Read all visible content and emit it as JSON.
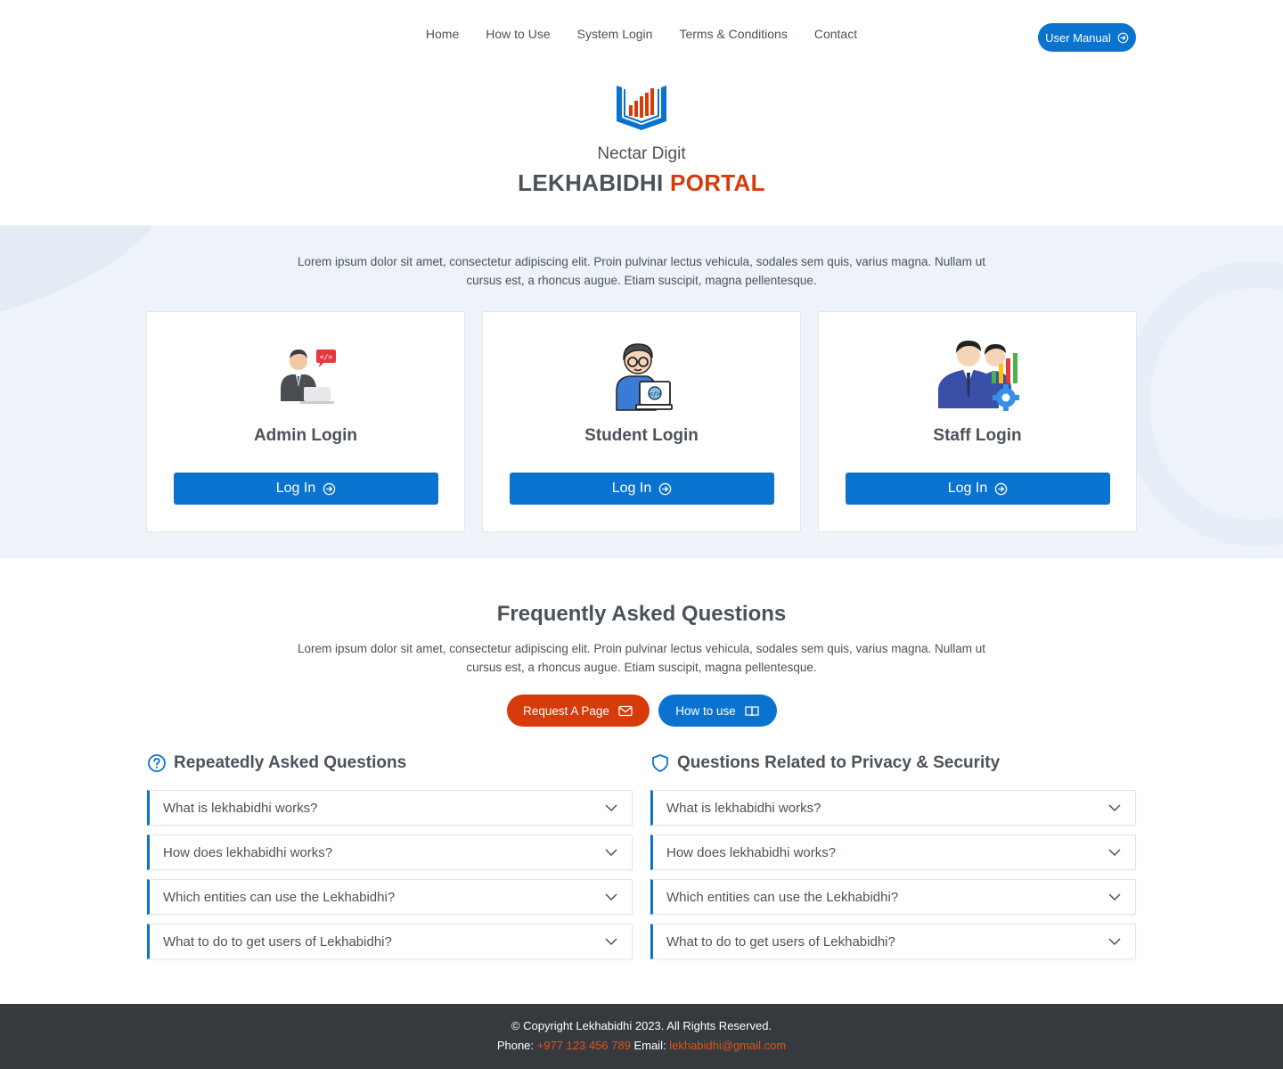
{
  "nav": {
    "links": [
      "Home",
      "How to Use",
      "System Login",
      "Terms & Conditions",
      "Contact"
    ],
    "manual_button": "User Manual"
  },
  "brand": {
    "org": "Nectar Digit",
    "title_part1": "LEKHABIDHI",
    "title_part2": "PORTAL",
    "logo_icon": "book-chart-logo"
  },
  "login": {
    "intro": "Lorem ipsum dolor sit amet, consectetur adipiscing elit. Proin pulvinar lectus vehicula, sodales sem quis, varius magna. Nullam ut cursus est, a rhoncus augue. Etiam suscipit, magna pellentesque.",
    "cards": [
      {
        "title": "Admin Login",
        "button": "Log In",
        "icon": "admin-illustration"
      },
      {
        "title": "Student Login",
        "button": "Log In",
        "icon": "student-illustration"
      },
      {
        "title": "Staff Login",
        "button": "Log In",
        "icon": "staff-illustration"
      }
    ]
  },
  "faq": {
    "title": "Frequently Asked Questions",
    "intro": "Lorem ipsum dolor sit amet, consectetur adipiscing elit. Proin pulvinar lectus vehicula, sodales sem quis, varius magna. Nullam ut cursus est, a rhoncus augue. Etiam suscipit, magna pellentesque.",
    "request_button": "Request A Page",
    "howto_button": "How to use",
    "left": {
      "heading": "Repeatedly Asked Questions",
      "items": [
        "What is lekhabidhi works?",
        "How does lekhabidhi works?",
        "Which entities can use the Lekhabidhi?",
        "What to do to get users of Lekhabidhi?"
      ]
    },
    "right": {
      "heading": "Questions Related to Privacy & Security",
      "items": [
        "What is lekhabidhi works?",
        "How does lekhabidhi works?",
        "Which entities can use the Lekhabidhi?",
        "What to do to get users of Lekhabidhi?"
      ]
    }
  },
  "footer": {
    "copyright": "© Copyright Lekhabidhi 2023. All Rights Reserved.",
    "phone_label": "Phone:",
    "phone": "+977 123 456 789",
    "email_label": "Email:",
    "email": "lekhabidhi@gmail.com"
  },
  "colors": {
    "primary": "#0a73d0",
    "accent": "#d83b0a",
    "footer_bg": "#363a3f",
    "section_bg": "#edf3f9"
  }
}
